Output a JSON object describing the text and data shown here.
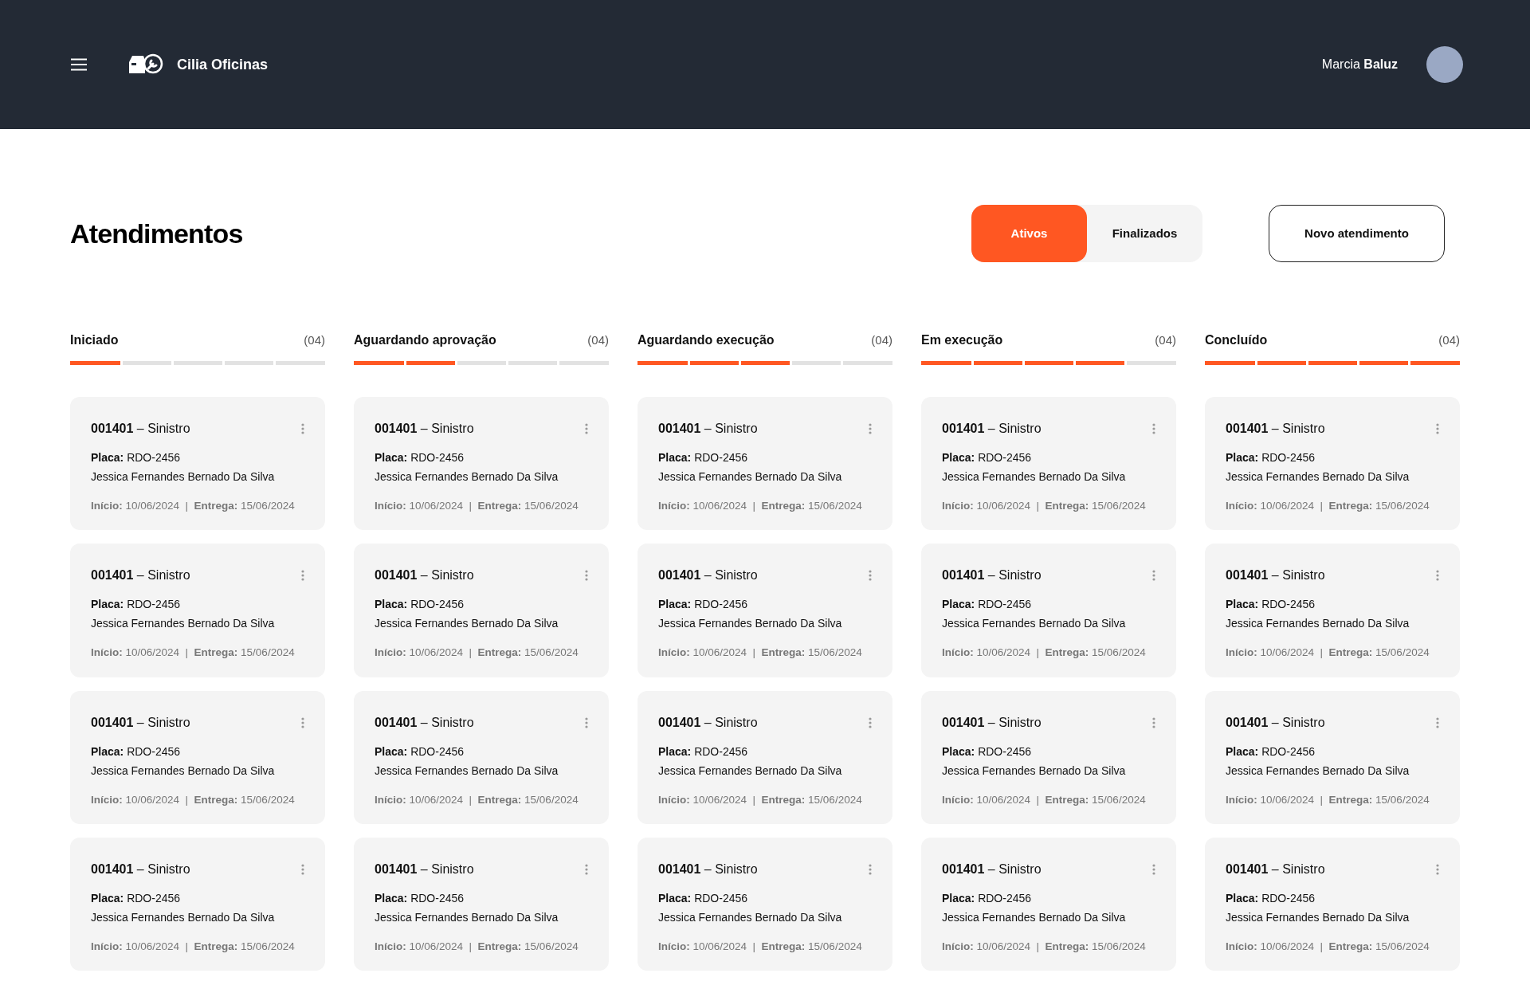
{
  "header": {
    "brand": "Cilia Oficinas",
    "user_first": "Marcia",
    "user_last": "Baluz"
  },
  "page": {
    "title": "Atendimentos",
    "tabs": [
      {
        "label": "Ativos",
        "selected": true
      },
      {
        "label": "Finalizados",
        "selected": false
      }
    ],
    "new_button": "Novo atendimento"
  },
  "columns": [
    {
      "title": "Iniciado",
      "count": "(04)",
      "level": 0.2,
      "cards": [
        {
          "title": "**001401** – Sinistro",
          "plate": "**Placa:** RDO-2456",
          "client": "Jessica Fernandes Bernado Da Silva",
          "dates": "**Início:** 10/06/2024  |  **Entrega:** 15/06/2024"
        },
        {
          "title": "**001401** – Sinistro",
          "plate": "**Placa:** RDO-2456",
          "client": "Jessica Fernandes Bernado Da Silva",
          "dates": "**Início:** 10/06/2024  |  **Entrega:** 15/06/2024"
        },
        {
          "title": "**001401** – Sinistro",
          "plate": "**Placa:** RDO-2456",
          "client": "Jessica Fernandes Bernado Da Silva",
          "dates": "**Início:** 10/06/2024  |  **Entrega:** 15/06/2024"
        },
        {
          "title": "**001401** – Sinistro",
          "plate": "**Placa:** RDO-2456",
          "client": "Jessica Fernandes Bernado Da Silva",
          "dates": "**Início:** 10/06/2024  |  **Entrega:** 15/06/2024"
        }
      ]
    },
    {
      "title": "Aguardando aprovação",
      "count": "(04)",
      "level": 0.4,
      "cards": [
        {
          "title": "**001401** – Sinistro",
          "plate": "**Placa:** RDO-2456",
          "client": "Jessica Fernandes Bernado Da Silva",
          "dates": "**Início:** 10/06/2024  |  **Entrega:** 15/06/2024"
        },
        {
          "title": "**001401** – Sinistro",
          "plate": "**Placa:** RDO-2456",
          "client": "Jessica Fernandes Bernado Da Silva",
          "dates": "**Início:** 10/06/2024  |  **Entrega:** 15/06/2024"
        },
        {
          "title": "**001401** – Sinistro",
          "plate": "**Placa:** RDO-2456",
          "client": "Jessica Fernandes Bernado Da Silva",
          "dates": "**Início:** 10/06/2024  |  **Entrega:** 15/06/2024"
        },
        {
          "title": "**001401** – Sinistro",
          "plate": "**Placa:** RDO-2456",
          "client": "Jessica Fernandes Bernado Da Silva",
          "dates": "**Início:** 10/06/2024  |  **Entrega:** 15/06/2024"
        }
      ]
    },
    {
      "title": "Aguardando execução",
      "count": "(04)",
      "level": 0.6,
      "cards": [
        {
          "title": "**001401** – Sinistro",
          "plate": "**Placa:** RDO-2456",
          "client": "Jessica Fernandes Bernado Da Silva",
          "dates": "**Início:** 10/06/2024  |  **Entrega:** 15/06/2024"
        },
        {
          "title": "**001401** – Sinistro",
          "plate": "**Placa:** RDO-2456",
          "client": "Jessica Fernandes Bernado Da Silva",
          "dates": "**Início:** 10/06/2024  |  **Entrega:** 15/06/2024"
        },
        {
          "title": "**001401** – Sinistro",
          "plate": "**Placa:** RDO-2456",
          "client": "Jessica Fernandes Bernado Da Silva",
          "dates": "**Início:** 10/06/2024  |  **Entrega:** 15/06/2024"
        },
        {
          "title": "**001401** – Sinistro",
          "plate": "**Placa:** RDO-2456",
          "client": "Jessica Fernandes Bernado Da Silva",
          "dates": "**Início:** 10/06/2024  |  **Entrega:** 15/06/2024"
        }
      ]
    },
    {
      "title": "Em execução",
      "count": "(04)",
      "level": 0.8,
      "cards": [
        {
          "title": "**001401** – Sinistro",
          "plate": "**Placa:** RDO-2456",
          "client": "Jessica Fernandes Bernado Da Silva",
          "dates": "**Início:** 10/06/2024  |  **Entrega:** 15/06/2024"
        },
        {
          "title": "**001401** – Sinistro",
          "plate": "**Placa:** RDO-2456",
          "client": "Jessica Fernandes Bernado Da Silva",
          "dates": "**Início:** 10/06/2024  |  **Entrega:** 15/06/2024"
        },
        {
          "title": "**001401** – Sinistro",
          "plate": "**Placa:** RDO-2456",
          "client": "Jessica Fernandes Bernado Da Silva",
          "dates": "**Início:** 10/06/2024  |  **Entrega:** 15/06/2024"
        },
        {
          "title": "**001401** – Sinistro",
          "plate": "**Placa:** RDO-2456",
          "client": "Jessica Fernandes Bernado Da Silva",
          "dates": "**Início:** 10/06/2024  |  **Entrega:** 15/06/2024"
        }
      ]
    },
    {
      "title": "Concluído",
      "count": "(04)",
      "level": 1,
      "cards": [
        {
          "title": "**001401** – Sinistro",
          "plate": "**Placa:** RDO-2456",
          "client": "Jessica Fernandes Bernado Da Silva",
          "dates": "**Início:** 10/06/2024  |  **Entrega:** 15/06/2024"
        },
        {
          "title": "**001401** – Sinistro",
          "plate": "**Placa:** RDO-2456",
          "client": "Jessica Fernandes Bernado Da Silva",
          "dates": "**Início:** 10/06/2024  |  **Entrega:** 15/06/2024"
        },
        {
          "title": "**001401** – Sinistro",
          "plate": "**Placa:** RDO-2456",
          "client": "Jessica Fernandes Bernado Da Silva",
          "dates": "**Início:** 10/06/2024  |  **Entrega:** 15/06/2024"
        },
        {
          "title": "**001401** – Sinistro",
          "plate": "**Placa:** RDO-2456",
          "client": "Jessica Fernandes Bernado Da Silva",
          "dates": "**Início:** 10/06/2024  |  **Entrega:** 15/06/2024"
        }
      ]
    }
  ]
}
